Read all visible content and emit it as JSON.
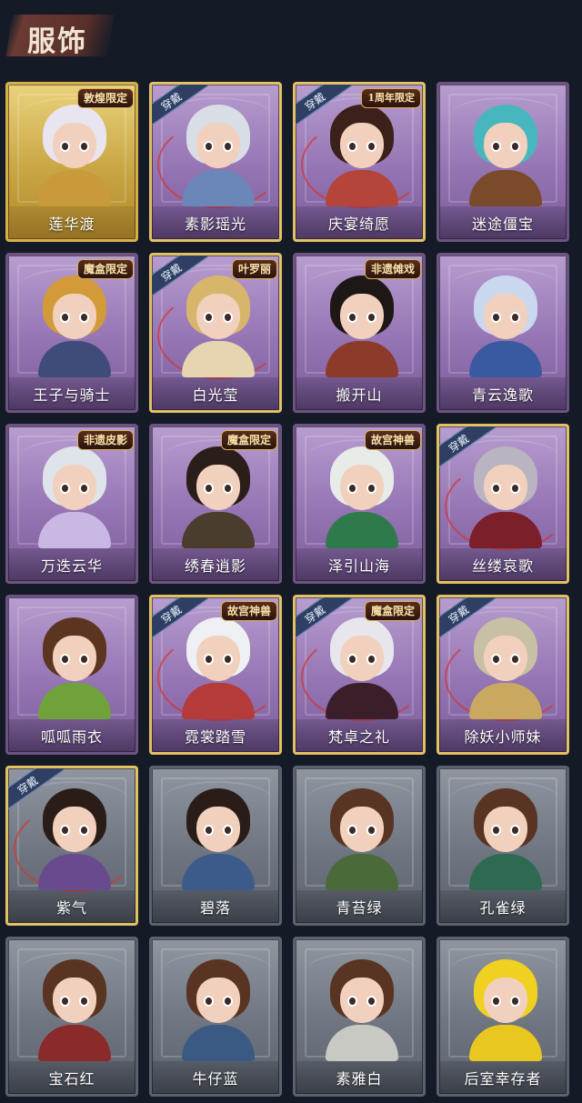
{
  "header": {
    "title": "服饰"
  },
  "selected_label": "穿戴",
  "colors": {
    "background": "#141b27",
    "purple_card": "#9574b3",
    "gold_card": "#c6a23f",
    "gray_card": "#6e7580",
    "badge_text": "#f7e3a8"
  },
  "cards": [
    {
      "name": "莲华渡",
      "tier": "gold",
      "worn": false,
      "badge": "敦煌限定",
      "hair": "#e8e4f0",
      "outfit": "#c89a3a"
    },
    {
      "name": "素影瑶光",
      "tier": "purple",
      "worn": true,
      "badge": "",
      "hair": "#d9dde6",
      "outfit": "#6b86b8"
    },
    {
      "name": "庆宴绮愿",
      "tier": "purple",
      "worn": true,
      "badge": "1周年限定",
      "hair": "#3b2119",
      "outfit": "#b5453a"
    },
    {
      "name": "迷途僵宝",
      "tier": "purple",
      "worn": false,
      "badge": "",
      "hair": "#48b7bd",
      "outfit": "#7a4a2a"
    },
    {
      "name": "王子与骑士",
      "tier": "purple",
      "worn": false,
      "badge": "魔盒限定",
      "hair": "#d39a3a",
      "outfit": "#3f4c7a"
    },
    {
      "name": "白光莹",
      "tier": "purple",
      "worn": true,
      "badge": "叶罗丽",
      "hair": "#d7b66c",
      "outfit": "#e6d5b0"
    },
    {
      "name": "搬开山",
      "tier": "purple",
      "worn": false,
      "badge": "非遗傩戏",
      "hair": "#1d1716",
      "outfit": "#8c3a2a"
    },
    {
      "name": "青云逸歌",
      "tier": "purple",
      "worn": false,
      "badge": "",
      "hair": "#c9d8ee",
      "outfit": "#3a5aa0"
    },
    {
      "name": "万迭云华",
      "tier": "purple",
      "worn": false,
      "badge": "非遗皮影",
      "hair": "#dfe3ea",
      "outfit": "#c9b7e4"
    },
    {
      "name": "绣春逍影",
      "tier": "purple",
      "worn": false,
      "badge": "魔盒限定",
      "hair": "#2a1e18",
      "outfit": "#4a3d2e"
    },
    {
      "name": "泽引山海",
      "tier": "purple",
      "worn": false,
      "badge": "故宫神兽",
      "hair": "#e8ece9",
      "outfit": "#2f7a4a"
    },
    {
      "name": "丝缕哀歌",
      "tier": "purple",
      "worn": true,
      "badge": "",
      "hair": "#b9b3c2",
      "outfit": "#7b1f2a"
    },
    {
      "name": "呱呱雨衣",
      "tier": "purple",
      "worn": false,
      "badge": "",
      "hair": "#5b3520",
      "outfit": "#6fa23a"
    },
    {
      "name": "霓裳踏雪",
      "tier": "purple",
      "worn": true,
      "badge": "故宫神兽",
      "hair": "#eef0f3",
      "outfit": "#b53a3a"
    },
    {
      "name": "梵卓之礼",
      "tier": "purple",
      "worn": true,
      "badge": "魔盒限定",
      "hair": "#e7e6ec",
      "outfit": "#3a1f2a"
    },
    {
      "name": "除妖小师妹",
      "tier": "purple",
      "worn": true,
      "badge": "",
      "hair": "#c7c0a4",
      "outfit": "#c9a860"
    },
    {
      "name": "紫气",
      "tier": "gray",
      "worn": true,
      "badge": "",
      "hair": "#2a1d17",
      "outfit": "#6a4a8e"
    },
    {
      "name": "碧落",
      "tier": "gray",
      "worn": false,
      "badge": "",
      "hair": "#2a1d17",
      "outfit": "#3c5a8a"
    },
    {
      "name": "青苔绿",
      "tier": "gray",
      "worn": false,
      "badge": "",
      "hair": "#5a3422",
      "outfit": "#4b6a3a"
    },
    {
      "name": "孔雀绿",
      "tier": "gray",
      "worn": false,
      "badge": "",
      "hair": "#5a3422",
      "outfit": "#2e6a52"
    },
    {
      "name": "宝石红",
      "tier": "gray",
      "worn": false,
      "badge": "",
      "hair": "#5a3422",
      "outfit": "#8a2a2a"
    },
    {
      "name": "牛仔蓝",
      "tier": "gray",
      "worn": false,
      "badge": "",
      "hair": "#5a3422",
      "outfit": "#3a5a84"
    },
    {
      "name": "素雅白",
      "tier": "gray",
      "worn": false,
      "badge": "",
      "hair": "#5a3422",
      "outfit": "#c9c9c4"
    },
    {
      "name": "后室幸存者",
      "tier": "gray",
      "worn": false,
      "badge": "",
      "hair": "#f0d020",
      "outfit": "#e8c820"
    }
  ]
}
